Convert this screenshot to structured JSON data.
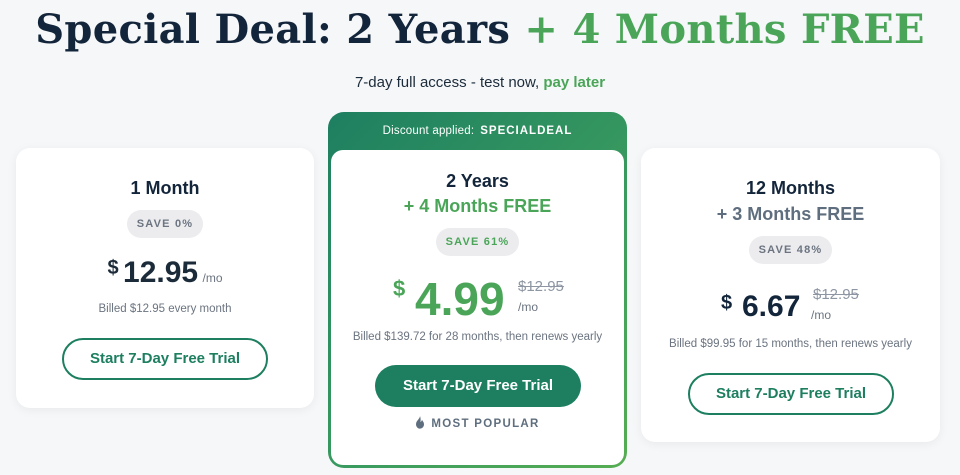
{
  "header": {
    "title_main": "Special Deal: 2 Years",
    "title_accent": "+ 4 Months FREE",
    "sub_text": "7-day full access - test now,",
    "sub_accent": "pay later"
  },
  "plans": [
    {
      "title": "1 Month",
      "badge": "SAVE 0%",
      "currency": "$",
      "price": "12.95",
      "per": "/mo",
      "billed": "Billed $12.95 every month",
      "cta": "Start 7-Day Free Trial"
    },
    {
      "discount_label": "Discount applied:",
      "discount_code": "SPECIALDEAL",
      "title": "2 Years",
      "subtitle": "+ 4 Months FREE",
      "badge": "SAVE 61%",
      "currency": "$",
      "price": "4.99",
      "old_price": "$12.95",
      "per": "/mo",
      "billed": "Billed $139.72 for 28 months, then renews yearly",
      "cta": "Start 7-Day Free Trial",
      "tag": "MOST POPULAR"
    },
    {
      "title": "12 Months",
      "subtitle": "+ 3 Months FREE",
      "badge": "SAVE 48%",
      "currency": "$",
      "price": "6.67",
      "old_price": "$12.95",
      "per": "/mo",
      "billed": "Billed $99.95 for 15 months, then renews yearly",
      "cta": "Start 7-Day Free Trial"
    }
  ],
  "colors": {
    "brand_green": "#1d7f60",
    "accent_green": "#4aa558",
    "navy": "#13253a"
  },
  "icons": {
    "popular": "flame-icon"
  }
}
